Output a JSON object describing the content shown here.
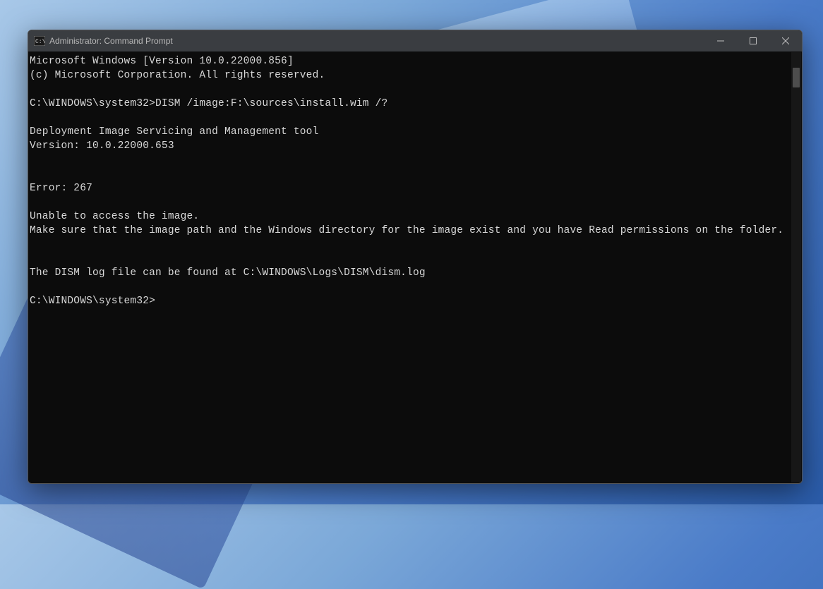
{
  "window": {
    "title": "Administrator: Command Prompt"
  },
  "terminal": {
    "lines": [
      "Microsoft Windows [Version 10.0.22000.856]",
      "(c) Microsoft Corporation. All rights reserved.",
      "",
      "C:\\WINDOWS\\system32>DISM /image:F:\\sources\\install.wim /?",
      "",
      "Deployment Image Servicing and Management tool",
      "Version: 10.0.22000.653",
      "",
      "",
      "Error: 267",
      "",
      "Unable to access the image.",
      "Make sure that the image path and the Windows directory for the image exist and you have Read permissions on the folder.",
      "",
      "",
      "The DISM log file can be found at C:\\WINDOWS\\Logs\\DISM\\dism.log",
      "",
      "C:\\WINDOWS\\system32>"
    ]
  }
}
